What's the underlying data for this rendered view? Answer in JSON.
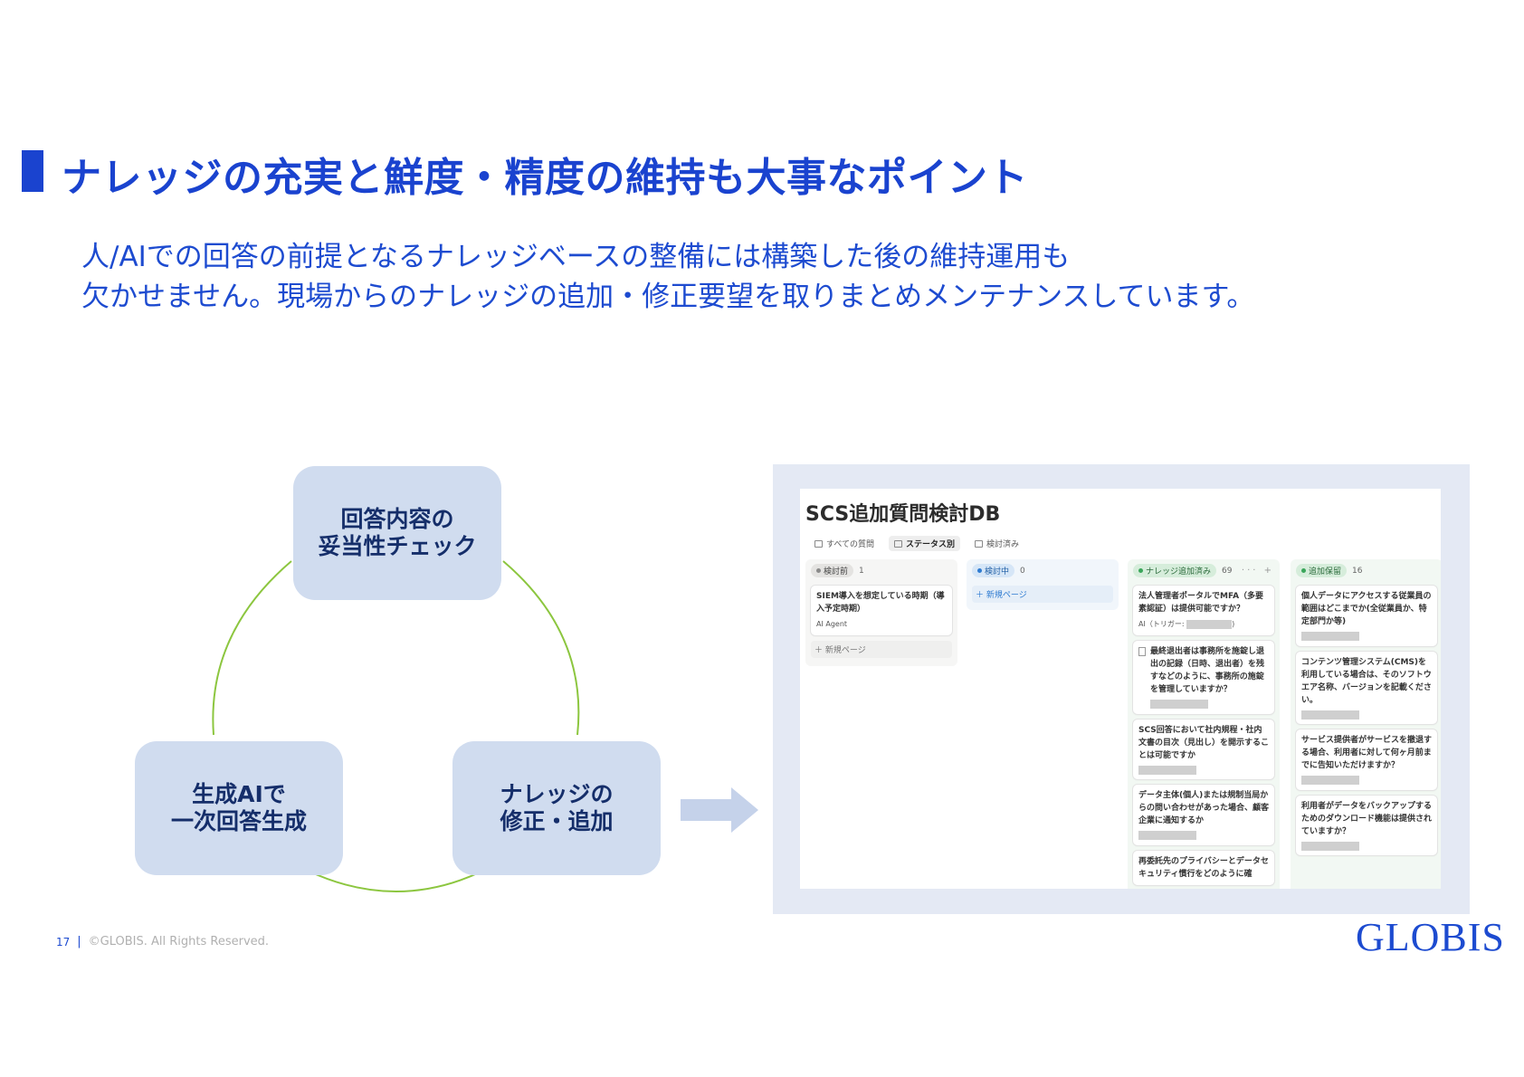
{
  "header": {
    "title": "ナレッジの充実と鮮度・精度の維持も大事なポイント",
    "lead_line1": "人/AIでの回答の前提となるナレッジベースの整備には構築した後の維持運用も",
    "lead_line2": "欠かせません。現場からのナレッジの追加・修正要望を取りまとめメンテナンスしています。"
  },
  "cycle": {
    "node_top": "回答内容の\n妥当性チェック",
    "node_left": "生成AIで\n一次回答生成",
    "node_right": "ナレッジの\n修正・追加"
  },
  "db": {
    "title": "SCS追加質問検討DB",
    "tabs": [
      "すべての質問",
      "ステータス別",
      "検討済み"
    ],
    "columns": [
      {
        "status": "検討前",
        "count": "1",
        "cards": [
          {
            "text": "SIEM導入を想定している時期（導入予定時期）",
            "sub": "AI Agent"
          }
        ],
        "new_page": "新規ページ"
      },
      {
        "status": "検討中",
        "count": "0",
        "new_page": "新規ページ"
      },
      {
        "status": "ナレッジ追加済み",
        "count": "69",
        "controls": "··· +",
        "cards": [
          {
            "text": "法人管理者ポータルでMFA（多要素認証）は提供可能ですか？",
            "sub": "AI（トリガー:"
          },
          {
            "text": "最終退出者は事務所を施錠し退出の記録（日時、退出者）を残すなどのように、事務所の施錠を管理していますか？"
          },
          {
            "text": "SCS回答において社内規程・社内文書の目次（見出し）を開示することは可能ですか"
          },
          {
            "text": "データ主体(個人)または規制当局からの問い合わせがあった場合、顧客企業に通知するか"
          },
          {
            "text": "再委託先のプライバシーとデータセキュリティ慣行をどのように確"
          }
        ]
      },
      {
        "status": "追加保留",
        "count": "16",
        "cards": [
          {
            "text": "個人データにアクセスする従業員の範囲はどこまでか(全従業員か、特定部門か等)"
          },
          {
            "text": "コンテンツ管理システム(CMS)を利用している場合は、そのソフトウエア名称、バージョンを記載ください。"
          },
          {
            "text": "サービス提供者がサービスを撤退する場合、利用者に対して何ヶ月前までに告知いただけますか？"
          },
          {
            "text": "利用者がデータをバックアップするためのダウンロード機能は提供されていますか？"
          }
        ]
      }
    ]
  },
  "footer": {
    "page": "17",
    "separator": "|",
    "copyright": "©GLOBIS. All Rights Reserved.",
    "logo": "GLOBIS"
  },
  "colors": {
    "brand": "#1a43cf",
    "node": "#d0dcef",
    "cycle_line": "#8cc63f",
    "arrow": "#c5d2ea",
    "panel": "#e4e9f4"
  }
}
